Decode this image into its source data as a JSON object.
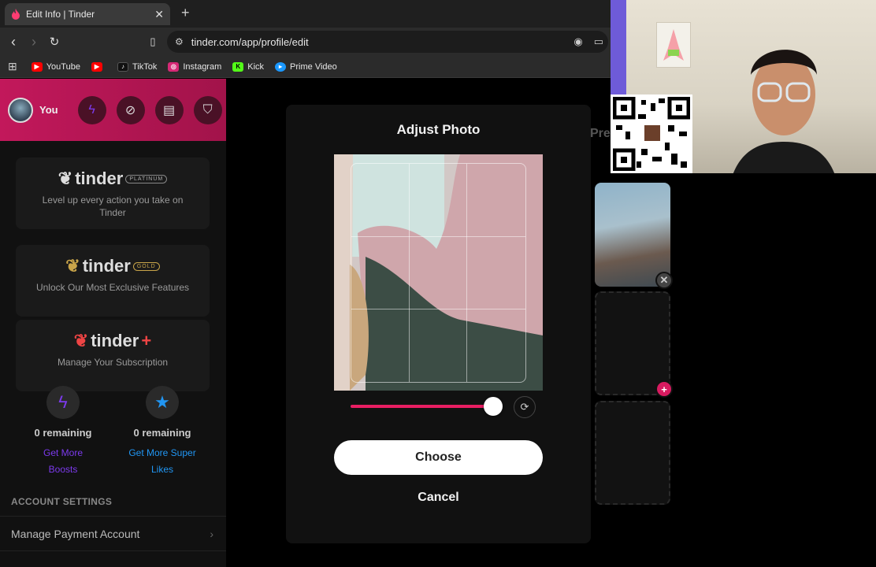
{
  "browser": {
    "tab_title": "Edit Info | Tinder",
    "new_tab_symbol": "+",
    "url": "tinder.com/app/profile/edit",
    "bookmarks": [
      {
        "label": "YouTube",
        "icon": "youtube-icon",
        "color": "#ff0000"
      },
      {
        "label": "",
        "icon": "youtube-icon",
        "color": "#ff0000"
      },
      {
        "label": "TikTok",
        "icon": "tiktok-icon",
        "color": "#000000"
      },
      {
        "label": "Instagram",
        "icon": "instagram-icon",
        "color": "#d62976"
      },
      {
        "label": "Kick",
        "icon": "kick-icon",
        "color": "#53fc18"
      },
      {
        "label": "Prime Video",
        "icon": "prime-video-icon",
        "color": "#1a98ff"
      }
    ]
  },
  "sidebar": {
    "user_label": "You",
    "promos": [
      {
        "brand": "tinder",
        "tier": "PLATINUM",
        "desc": "Level up every action you take on Tinder"
      },
      {
        "brand": "tinder",
        "tier": "GOLD",
        "desc": "Unlock Our Most Exclusive Features"
      },
      {
        "brand": "tinder",
        "tier": "+",
        "desc": "Manage Your Subscription"
      }
    ],
    "boosts": {
      "remaining": "0 remaining",
      "link": "Get More Boosts",
      "color": "#7c3aed"
    },
    "super_likes": {
      "remaining": "0 remaining",
      "link": "Get More Super Likes",
      "color": "#2196f3"
    },
    "account_settings_title": "ACCOUNT SETTINGS",
    "account_rows": [
      {
        "label": "Manage Payment Account"
      }
    ]
  },
  "modal": {
    "title": "Adjust Photo",
    "zoom_level": 1.0,
    "choose_label": "Choose",
    "cancel_label": "Cancel"
  },
  "background": {
    "preview_fragment": "Pre"
  },
  "colors": {
    "accent": "#e91e63",
    "brand_gradient_start": "#c2185b"
  }
}
